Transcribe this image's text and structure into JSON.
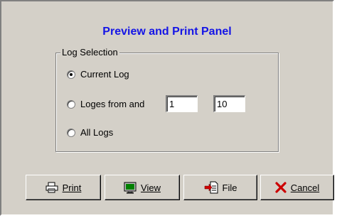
{
  "title": "Preview and Print Panel",
  "group": {
    "legend": "Log Selection",
    "options": [
      {
        "label": "Current Log",
        "checked": true
      },
      {
        "label": "Loges from and",
        "checked": false
      },
      {
        "label": "All Logs",
        "checked": false
      }
    ],
    "from_value": "1",
    "to_value": "10"
  },
  "buttons": {
    "print": {
      "label": "Print",
      "icon": "printer-icon"
    },
    "view": {
      "label": "View",
      "icon": "monitor-icon"
    },
    "file": {
      "label": "File",
      "icon": "file-export-icon"
    },
    "cancel": {
      "label": "Cancel",
      "icon": "red-x-icon",
      "icon_color": "#cc0000"
    }
  }
}
